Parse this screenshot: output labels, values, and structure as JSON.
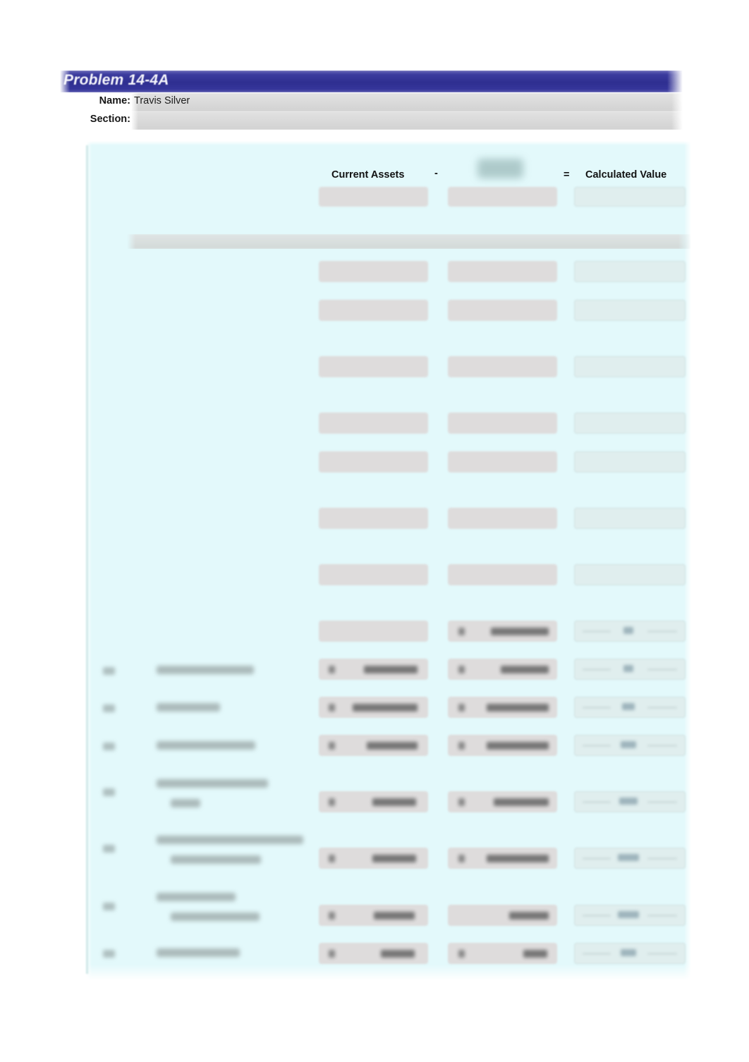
{
  "document": {
    "title": "Problem 14-4A",
    "meta": {
      "name_label": "Name:",
      "name_value": "Travis Silver",
      "section_label": "Section:",
      "section_value": ""
    }
  },
  "worksheet": {
    "column_headers": {
      "col_a": "Current Assets",
      "operator_minus": "-",
      "col_b": "",
      "operator_equals": "=",
      "col_c": "Calculated Value"
    },
    "column_header_notes": {
      "col_b_state": "redacted"
    },
    "rows": [
      {
        "number": "",
        "label": "",
        "col_a": "",
        "col_b": "",
        "col_c": "",
        "state": "empty"
      },
      {
        "number": "",
        "label": "",
        "col_a": "",
        "col_b": "",
        "col_c": "",
        "state": "empty"
      },
      {
        "number": "",
        "label": "",
        "col_a": "",
        "col_b": "",
        "col_c": "",
        "state": "empty"
      },
      {
        "number": "",
        "label": "",
        "col_a": "",
        "col_b": "",
        "col_c": "",
        "state": "empty"
      },
      {
        "number": "",
        "label": "",
        "col_a": "",
        "col_b": "",
        "col_c": "",
        "state": "empty"
      },
      {
        "number": "",
        "label": "",
        "col_a": "",
        "col_b": "",
        "col_c": "",
        "state": "empty"
      },
      {
        "number": "",
        "label": "",
        "col_a": "",
        "col_b": "",
        "col_c": "",
        "state": "empty"
      },
      {
        "number": "",
        "label": "",
        "col_a": "",
        "col_b": "",
        "col_c": "",
        "state": "redacted"
      },
      {
        "number": "",
        "label": "",
        "col_a": "",
        "col_b": "",
        "col_c": "",
        "state": "redacted"
      },
      {
        "number": "",
        "label": "",
        "col_a": "",
        "col_b": "",
        "col_c": "",
        "state": "redacted"
      },
      {
        "number": "",
        "label": "",
        "col_a": "",
        "col_b": "",
        "col_c": "",
        "state": "redacted"
      },
      {
        "number": "",
        "label": "",
        "col_a": "",
        "col_b": "",
        "col_c": "",
        "state": "redacted"
      },
      {
        "number": "",
        "label": "",
        "col_a": "",
        "col_b": "",
        "col_c": "",
        "state": "redacted"
      },
      {
        "number": "",
        "label": "",
        "col_a": "",
        "col_b": "",
        "col_c": "",
        "state": "redacted"
      },
      {
        "number": "",
        "label": "",
        "col_a": "",
        "col_b": "",
        "col_c": "",
        "state": "redacted"
      }
    ]
  },
  "colors": {
    "title_bar": "#2f2f91",
    "panel_background": "#e3f9fb",
    "field_fill": "#dedcdc",
    "result_field_fill": "#e0eeee",
    "meta_field_fill": "#dadada"
  }
}
